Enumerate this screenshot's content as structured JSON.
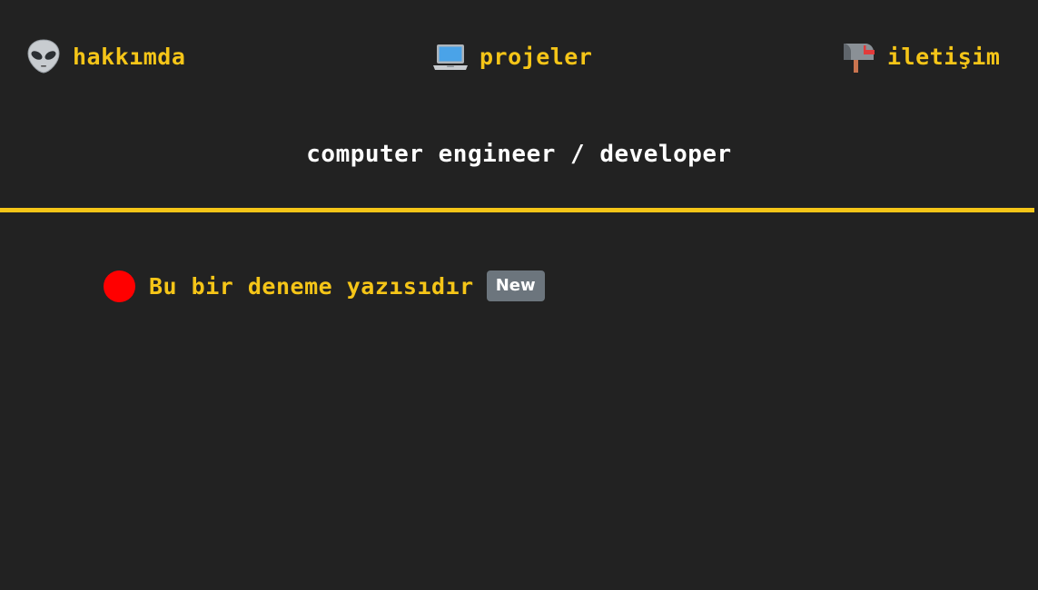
{
  "nav": {
    "items": [
      {
        "label": "hakkımda",
        "icon": "alien-icon"
      },
      {
        "label": "projeler",
        "icon": "laptop-icon"
      },
      {
        "label": "iletişim",
        "icon": "mailbox-icon"
      }
    ]
  },
  "header": {
    "subtitle": "computer engineer / developer"
  },
  "posts": [
    {
      "title": "Bu bir deneme yazısıdır",
      "badge": "New",
      "status_color": "#ff0000"
    }
  ],
  "colors": {
    "background": "#222222",
    "accent": "#f5c518",
    "text": "#ffffff",
    "badge": "#6c757d"
  }
}
